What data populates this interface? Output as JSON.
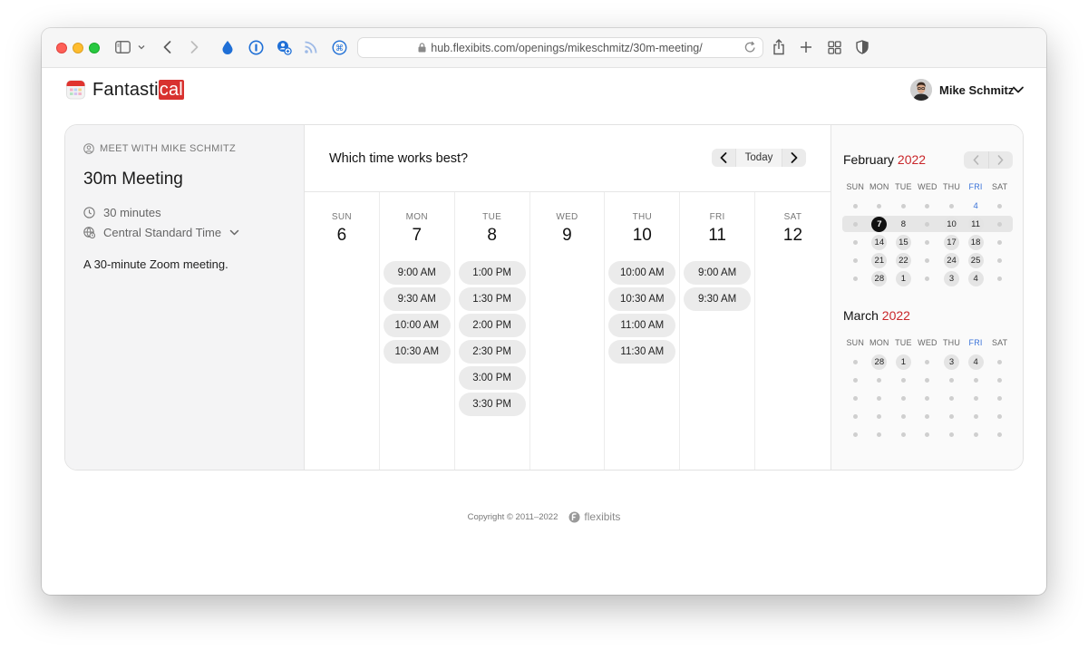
{
  "browser": {
    "url": "hub.flexibits.com/openings/mikeschmitz/30m-meeting/"
  },
  "app": {
    "logo_text_prefix": "Fantasti",
    "logo_text_suffix": "cal",
    "user_name": "Mike Schmitz"
  },
  "meeting": {
    "meet_with": "MEET WITH MIKE SCHMITZ",
    "title": "30m Meeting",
    "duration": "30 minutes",
    "timezone": "Central Standard Time",
    "description": "A 30-minute Zoom meeting."
  },
  "scheduler": {
    "prompt": "Which time works best?",
    "today_label": "Today",
    "days": [
      {
        "dow": "SUN",
        "num": "6",
        "slots": []
      },
      {
        "dow": "MON",
        "num": "7",
        "slots": [
          "9:00 AM",
          "9:30 AM",
          "10:00 AM",
          "10:30 AM"
        ]
      },
      {
        "dow": "TUE",
        "num": "8",
        "slots": [
          "1:00 PM",
          "1:30 PM",
          "2:00 PM",
          "2:30 PM",
          "3:00 PM",
          "3:30 PM"
        ]
      },
      {
        "dow": "WED",
        "num": "9",
        "slots": []
      },
      {
        "dow": "THU",
        "num": "10",
        "slots": [
          "10:00 AM",
          "10:30 AM",
          "11:00 AM",
          "11:30 AM"
        ]
      },
      {
        "dow": "FRI",
        "num": "11",
        "slots": [
          "9:00 AM",
          "9:30 AM"
        ]
      },
      {
        "dow": "SAT",
        "num": "12",
        "slots": []
      }
    ]
  },
  "mini_calendars": {
    "weekday_headers": [
      "SUN",
      "MON",
      "TUE",
      "WED",
      "THU",
      "FRI",
      "SAT"
    ],
    "highlighted_weekday": "FRI",
    "months": [
      {
        "month": "February",
        "year": "2022",
        "weeks": [
          [
            null,
            null,
            null,
            null,
            null,
            "b:4",
            null
          ],
          [
            null,
            "s:7",
            "p:8",
            null,
            "c:10",
            "c:11",
            null
          ],
          [
            null,
            "c:14",
            "c:15",
            null,
            "c:17",
            "c:18",
            null
          ],
          [
            null,
            "c:21",
            "c:22",
            null,
            "c:24",
            "c:25",
            null
          ],
          [
            null,
            "c:28",
            "c:1",
            null,
            "c:3",
            "c:4",
            null
          ]
        ],
        "selected_week_index": 1
      },
      {
        "month": "March",
        "year": "2022",
        "weeks": [
          [
            null,
            "c:28",
            "c:1",
            null,
            "c:3",
            "c:4",
            null
          ],
          [
            null,
            null,
            null,
            null,
            null,
            null,
            null
          ],
          [
            null,
            null,
            null,
            null,
            null,
            null,
            null
          ],
          [
            null,
            null,
            null,
            null,
            null,
            null,
            null
          ],
          [
            null,
            null,
            null,
            null,
            null,
            null,
            null
          ]
        ],
        "selected_week_index": -1
      }
    ]
  },
  "footer": {
    "copyright": "Copyright © 2011–2022",
    "brand": "flexibits"
  }
}
